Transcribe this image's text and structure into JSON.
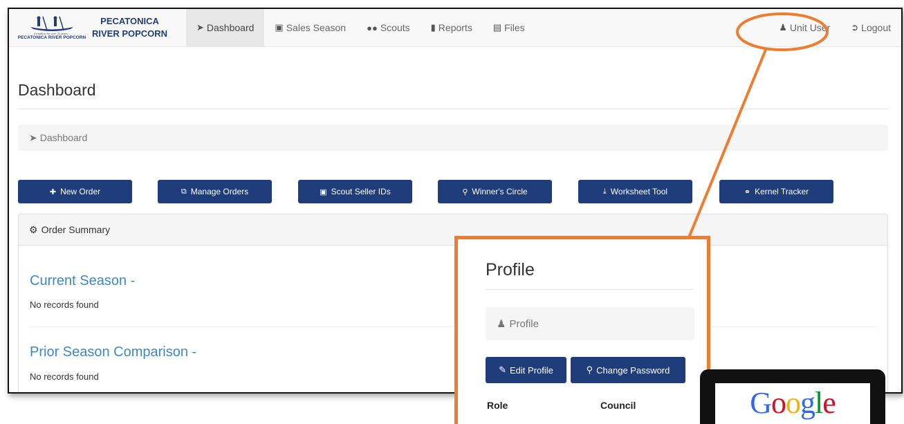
{
  "brand": {
    "logo_tagline": "A tradition for over 25 years...",
    "logo_text": "PECATONICA RIVER POPCORN",
    "name_line1": "PECATONICA",
    "name_line2": "RIVER POPCORN"
  },
  "nav": {
    "items": [
      {
        "label": "Dashboard",
        "icon": "rocket-icon",
        "active": true
      },
      {
        "label": "Sales Season",
        "icon": "file-icon"
      },
      {
        "label": "Scouts",
        "icon": "users-icon"
      },
      {
        "label": "Reports",
        "icon": "bar-chart-icon"
      },
      {
        "label": "Files",
        "icon": "image-file-icon"
      }
    ],
    "user_label": "Unit User",
    "logout_label": "Logout"
  },
  "page": {
    "title": "Dashboard",
    "breadcrumb": "Dashboard"
  },
  "actions": [
    {
      "label": "New Order",
      "icon": "plus-icon"
    },
    {
      "label": "Manage Orders",
      "icon": "copy-icon"
    },
    {
      "label": "Scout Seller IDs",
      "icon": "id-card-icon"
    },
    {
      "label": "Winner's Circle",
      "icon": "trophy-icon"
    },
    {
      "label": "Worksheet Tool",
      "icon": "download-icon"
    },
    {
      "label": "Kernel Tracker",
      "icon": "link-icon"
    }
  ],
  "order_summary": {
    "heading": "Order Summary",
    "current_season_title": "Current Season -",
    "current_season_empty": "No records found",
    "prior_season_title": "Prior Season Comparison -",
    "prior_season_empty": "No records found"
  },
  "profile": {
    "title": "Profile",
    "breadcrumb": "Profile",
    "edit_label": "Edit Profile",
    "change_password_label": "Change Password",
    "col_role": "Role",
    "col_council": "Council"
  },
  "google": {
    "letters": [
      "G",
      "o",
      "o",
      "g",
      "l",
      "e"
    ],
    "colors": [
      "#3369e8",
      "#d50f25",
      "#eeb211",
      "#3369e8",
      "#009925",
      "#d50f25"
    ]
  },
  "colors": {
    "primary": "#1f3d7a",
    "link": "#3f88c5",
    "callout": "#ed7d31"
  }
}
